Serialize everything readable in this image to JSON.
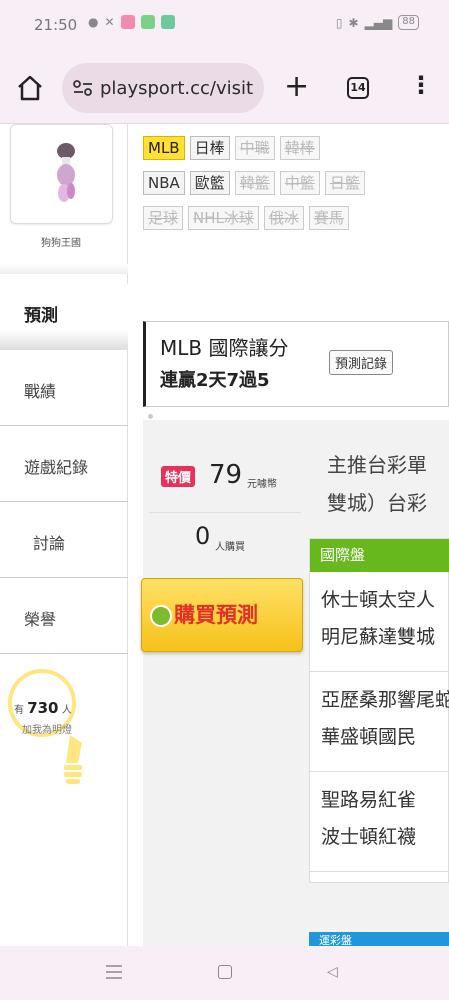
{
  "status_bar": {
    "time": "21:50",
    "battery": "88"
  },
  "browser": {
    "url": "playsport.cc/visit",
    "tab_count": "14"
  },
  "sidebar": {
    "username": "狗狗王國",
    "active_tab": "預測",
    "items": [
      "戰績",
      "遊戲紀錄",
      "討論",
      "榮譽"
    ],
    "fans": {
      "prefix": "有",
      "count": "730",
      "suffix": "人",
      "caption": "加我為明燈"
    }
  },
  "leagues": {
    "row1": [
      {
        "label": "MLB",
        "state": "active"
      },
      {
        "label": "日棒",
        "state": "normal"
      },
      {
        "label": "中職",
        "state": "disabled"
      },
      {
        "label": "韓棒",
        "state": "disabled"
      }
    ],
    "row2": [
      {
        "label": "NBA",
        "state": "normal"
      },
      {
        "label": "歐籃",
        "state": "normal"
      },
      {
        "label": "韓籃",
        "state": "disabled"
      },
      {
        "label": "中籃",
        "state": "disabled"
      },
      {
        "label": "日籃",
        "state": "disabled"
      }
    ],
    "row3": [
      {
        "label": "足球",
        "state": "disabled"
      },
      {
        "label": "NHL冰球",
        "state": "disabled"
      },
      {
        "label": "俄冰",
        "state": "disabled"
      },
      {
        "label": "賽馬",
        "state": "disabled"
      }
    ]
  },
  "header": {
    "title": "MLB 國際讓分",
    "streak": "連贏2天7過5",
    "record_button": "預測記錄"
  },
  "offer": {
    "badge": "特價",
    "price": "79",
    "price_unit": "元噱幣",
    "buyers": "0",
    "buyers_unit": "人購買",
    "buy_button": "購買預測"
  },
  "pick": {
    "title_line1": "主推台彩單",
    "title_line2": "雙城）台彩",
    "section": "國際盤",
    "matches": [
      {
        "line1": "休士頓太空人",
        "line2": "明尼蘇達雙城"
      },
      {
        "line1": "亞歷桑那響尾蛇",
        "line2": "華盛頓國民"
      },
      {
        "line1": "聖路易紅雀",
        "line2": "波士頓紅襪"
      }
    ],
    "next_section": "運彩盤"
  }
}
